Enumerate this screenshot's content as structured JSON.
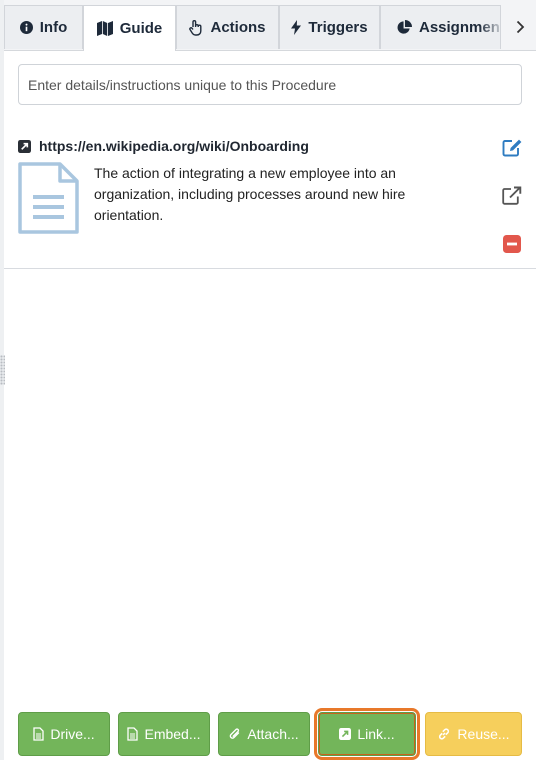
{
  "tabs": [
    {
      "id": "info",
      "label": "Info",
      "icon": "info-icon",
      "active": false
    },
    {
      "id": "guide",
      "label": "Guide",
      "icon": "map-icon",
      "active": true
    },
    {
      "id": "actions",
      "label": "Actions",
      "icon": "pointer-hand-icon",
      "active": false
    },
    {
      "id": "triggers",
      "label": "Triggers",
      "icon": "lightning-icon",
      "active": false
    },
    {
      "id": "assignment",
      "label": "Assignment",
      "icon": "pie-chart-icon",
      "active": false
    }
  ],
  "instructions": {
    "placeholder": "Enter details/instructions unique to this Procedure",
    "value": ""
  },
  "link_item": {
    "url": "https://en.wikipedia.org/wiki/Onboarding",
    "description": "The action of integrating a new employee into an organization, including processes around new hire orientation."
  },
  "buttons": [
    {
      "label": "Drive...",
      "icon": "document-icon",
      "color": "#73b55a"
    },
    {
      "label": "Embed...",
      "icon": "document-icon",
      "color": "#73b55a"
    },
    {
      "label": "Attach...",
      "icon": "paperclip-icon",
      "color": "#73b55a"
    },
    {
      "label": "Link...",
      "icon": "external-link-square-icon",
      "color": "#73b55a",
      "highlighted": true
    },
    {
      "label": "Reuse...",
      "icon": "link-chain-icon",
      "color": "#f6cf5c"
    }
  ],
  "colors": {
    "accent": "#2f7cc1",
    "danger": "#e2574c",
    "highlight": "#e8782a"
  }
}
